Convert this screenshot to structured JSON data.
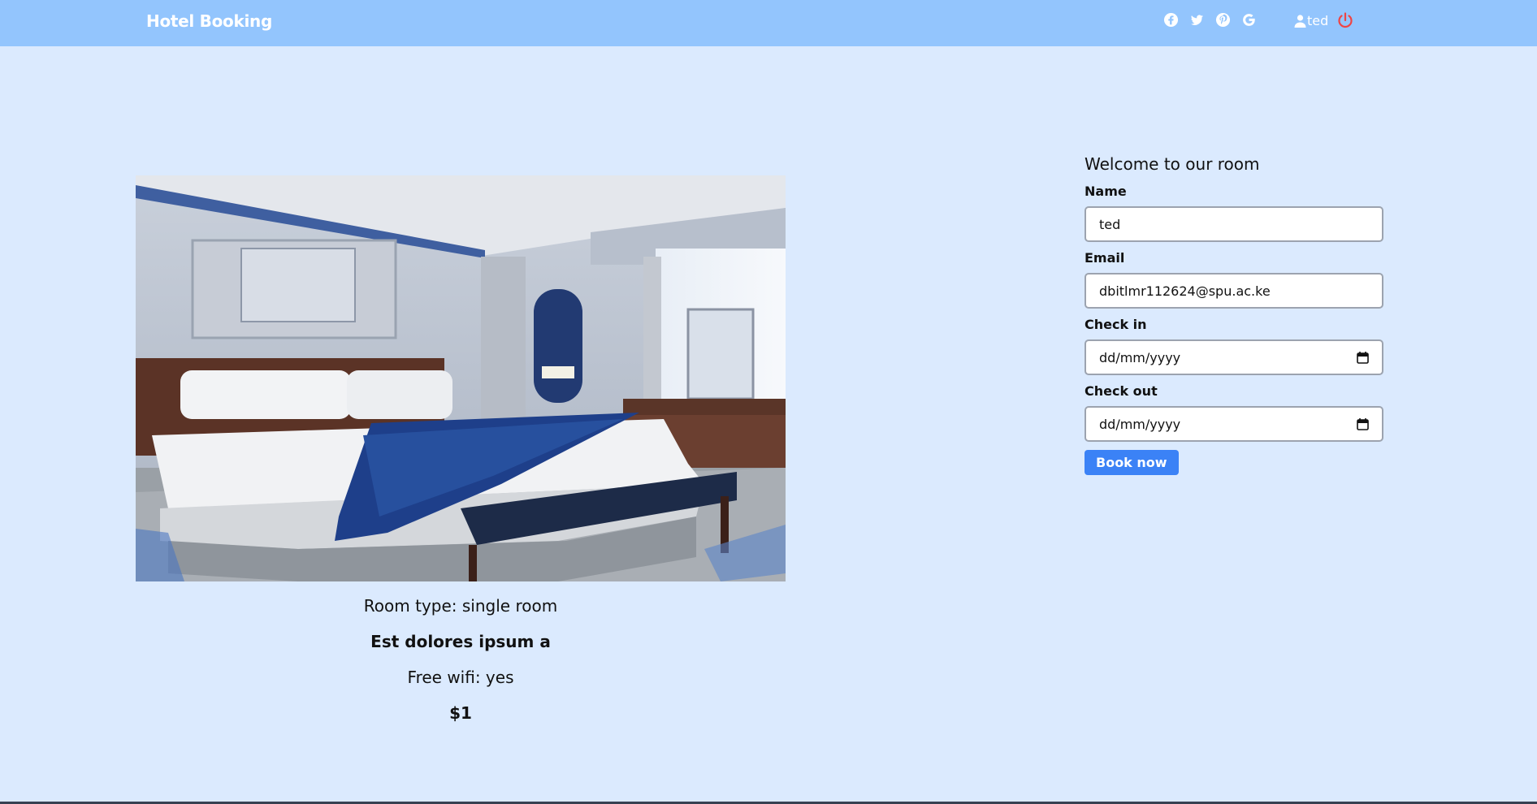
{
  "header": {
    "brand": "Hotel Booking",
    "social_icons": [
      "facebook-icon",
      "twitter-icon",
      "pinterest-icon",
      "google-icon"
    ],
    "user_name": "ted",
    "logout_icon": "power-icon",
    "logout_color": "#ef4444",
    "background": "#93c5fd"
  },
  "room": {
    "type_text": "Room type: single room",
    "name": "Est dolores ipsum a",
    "wifi_text": "Free wifi: yes",
    "price": "$1"
  },
  "form": {
    "title": "Welcome to our room",
    "name_label": "Name",
    "name_value": "ted",
    "email_label": "Email",
    "email_value": "dbitlmr112624@spu.ac.ke",
    "checkin_label": "Check in",
    "checkin_placeholder": "dd/mm/yyyy",
    "checkout_label": "Check out",
    "checkout_placeholder": "dd/mm/yyyy",
    "submit_label": "Book now",
    "accent": "#3b82f6"
  },
  "page_background": "#dbeafe"
}
